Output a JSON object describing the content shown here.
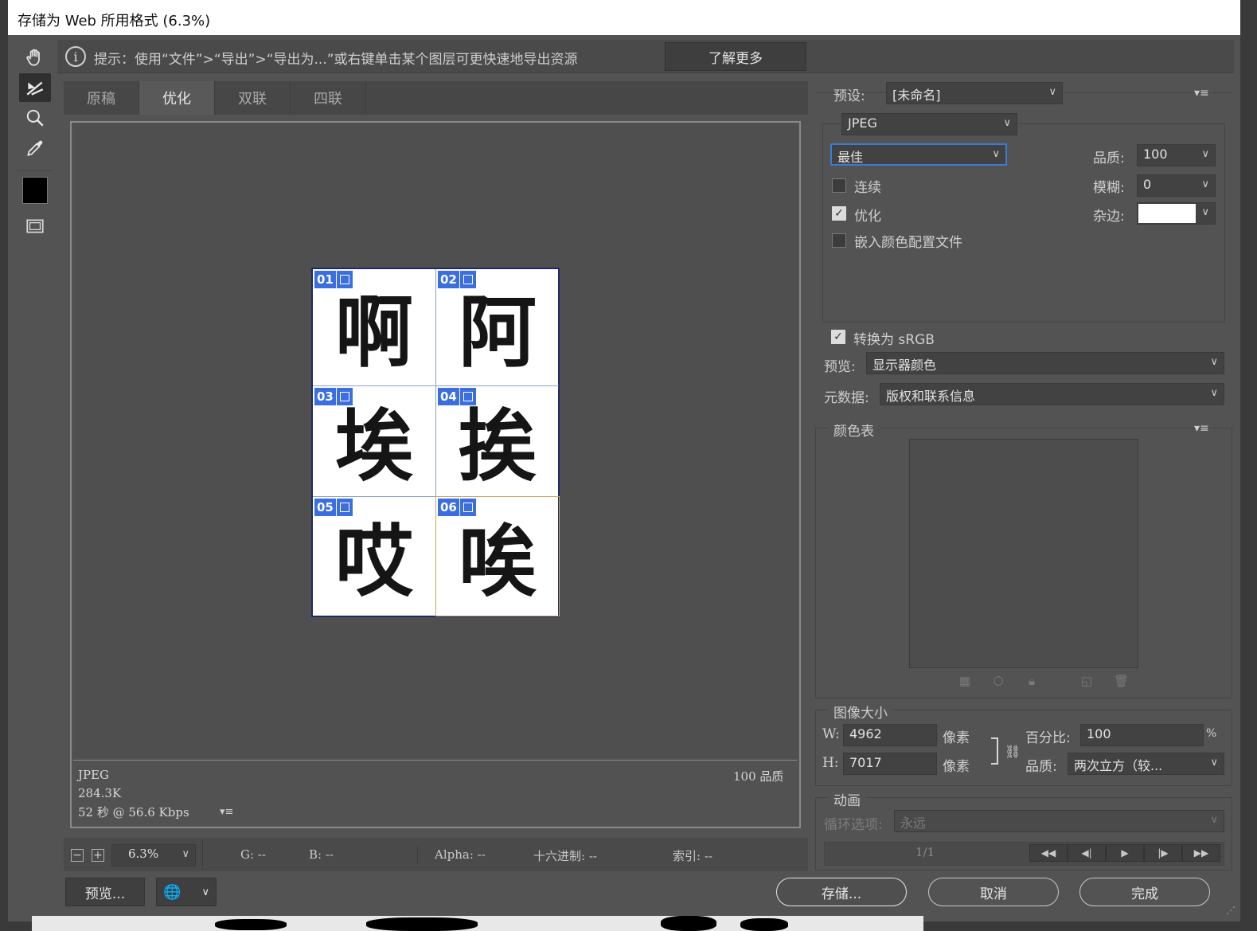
{
  "window": {
    "title": "存储为 Web 所用格式 (6.3%)"
  },
  "hint": {
    "text": "提示：使用“文件”>“导出”>“导出为...”或右键单击某个图层可更快速地导出资源",
    "learn_more": "了解更多"
  },
  "tools": [
    "hand-tool-icon",
    "slice-select-tool-icon",
    "zoom-tool-icon",
    "eyedropper-tool-icon",
    "color-swatch",
    "toggle-slices-icon"
  ],
  "tabs": [
    {
      "label": "原稿",
      "active": false
    },
    {
      "label": "优化",
      "active": true
    },
    {
      "label": "双联",
      "active": false
    },
    {
      "label": "四联",
      "active": false
    }
  ],
  "slices": [
    {
      "num": "01",
      "char": "啊"
    },
    {
      "num": "02",
      "char": "阿"
    },
    {
      "num": "03",
      "char": "埃"
    },
    {
      "num": "04",
      "char": "挨"
    },
    {
      "num": "05",
      "char": "哎"
    },
    {
      "num": "06",
      "char": "唉"
    }
  ],
  "preview_info": {
    "format": "JPEG",
    "size": "284.3K",
    "time": "52 秒 @ 56.6 Kbps",
    "quality": "100 品质"
  },
  "statusbar": {
    "zoom": "6.3%",
    "g": "G: --",
    "b": "B: --",
    "alpha": "Alpha: --",
    "hex": "十六进制: --",
    "index": "索引: --"
  },
  "bottom": {
    "preview": "预览...",
    "save": "存储...",
    "cancel": "取消",
    "done": "完成"
  },
  "settings": {
    "preset_label": "预设:",
    "preset_value": "[未命名]",
    "format": "JPEG",
    "quality_preset": "最佳",
    "quality_label": "品质:",
    "quality_value": "100",
    "blur_label": "模糊:",
    "blur_value": "0",
    "matte_label": "杂边:",
    "matte_color": "#ffffff",
    "progressive_label": "连续",
    "progressive": false,
    "optimized_label": "优化",
    "optimized": true,
    "embed_label": "嵌入颜色配置文件",
    "embed": false,
    "srgb_label": "转换为 sRGB",
    "srgb": true,
    "preview_label": "预览:",
    "preview_value": "显示器颜色",
    "metadata_label": "元数据:",
    "metadata_value": "版权和联系信息"
  },
  "color_table": {
    "title": "颜色表"
  },
  "image_size": {
    "title": "图像大小",
    "w_label": "W:",
    "w_value": "4962",
    "h_label": "H:",
    "h_value": "7017",
    "unit": "像素",
    "percent_label": "百分比:",
    "percent_value": "100",
    "percent_sign": "%",
    "quality_label": "品质:",
    "quality_value": "两次立方（较..."
  },
  "animation": {
    "title": "动画",
    "loop_label": "循环选项:",
    "loop_value": "永远",
    "frame": "1/1"
  }
}
